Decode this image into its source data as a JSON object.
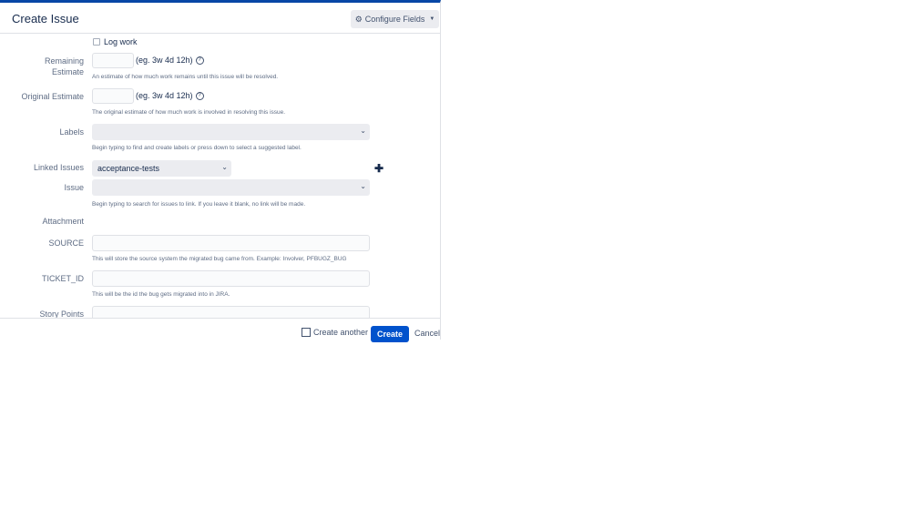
{
  "dialog": {
    "title": "Create Issue",
    "configure_fields_label": "Configure Fields"
  },
  "form": {
    "log_work_label": "Log work",
    "remaining_estimate": {
      "label": "Remaining Estimate",
      "value": "",
      "hint": "(eg. 3w 4d 12h)",
      "help": "An estimate of how much work remains until this issue will be resolved."
    },
    "original_estimate": {
      "label": "Original Estimate",
      "value": "",
      "hint": "(eg. 3w 4d 12h)",
      "help": "The original estimate of how much work is involved in resolving this issue."
    },
    "labels": {
      "label": "Labels",
      "value": "",
      "help": "Begin typing to find and create labels or press down to select a suggested label."
    },
    "linked_issues": {
      "label": "Linked Issues",
      "selected": "acceptance-tests"
    },
    "issue": {
      "label": "Issue",
      "value": "",
      "help": "Begin typing to search for issues to link. If you leave it blank, no link will be made."
    },
    "attachment": {
      "label": "Attachment"
    },
    "source": {
      "label": "SOURCE",
      "value": "",
      "help": "This will store the source system the migrated bug came from. Example: Involver, PFBUGZ_BUG"
    },
    "ticket_id": {
      "label": "TICKET_ID",
      "value": "",
      "help": "This will be the id the bug gets migrated into in JIRA."
    },
    "story_points": {
      "label": "Story Points",
      "value": ""
    }
  },
  "footer": {
    "create_another_label": "Create another",
    "create_label": "Create",
    "cancel_label": "Cancel"
  },
  "colors": {
    "primary": "#0052cc",
    "header_border": "#0747a6",
    "text": "#172b4d",
    "muted": "#5e6c84"
  },
  "icons": [
    "gear-icon",
    "caret-down-icon",
    "help-icon",
    "chevron-down-icon",
    "plus-icon",
    "checkbox-icon"
  ]
}
